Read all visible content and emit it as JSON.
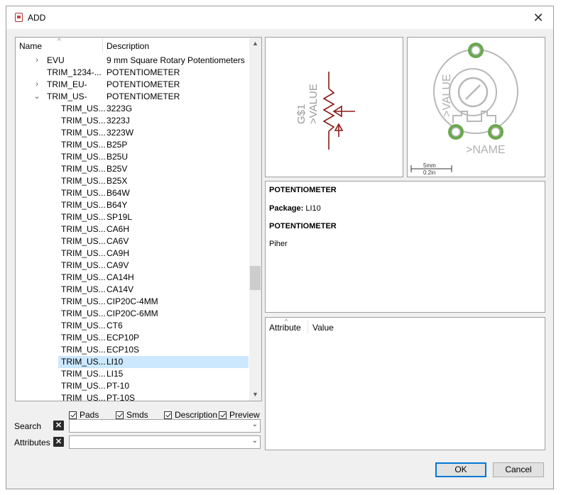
{
  "window": {
    "title": "ADD"
  },
  "tree": {
    "col_name": "Name",
    "col_desc": "Description",
    "rows": [
      {
        "name": "EVU",
        "desc": "9 mm Square Rotary Potentiometers",
        "level": 0,
        "toggle": "collapsed"
      },
      {
        "name": "TRIM_1234-...",
        "desc": "POTENTIOMETER",
        "level": 0,
        "toggle": "none"
      },
      {
        "name": "TRIM_EU-",
        "desc": "POTENTIOMETER",
        "level": 0,
        "toggle": "collapsed"
      },
      {
        "name": "TRIM_US-",
        "desc": "POTENTIOMETER",
        "level": 0,
        "toggle": "expanded"
      },
      {
        "name": "TRIM_US...",
        "desc": "3223G",
        "level": 1
      },
      {
        "name": "TRIM_US...",
        "desc": "3223J",
        "level": 1
      },
      {
        "name": "TRIM_US...",
        "desc": "3223W",
        "level": 1
      },
      {
        "name": "TRIM_US...",
        "desc": "B25P",
        "level": 1
      },
      {
        "name": "TRIM_US...",
        "desc": "B25U",
        "level": 1
      },
      {
        "name": "TRIM_US...",
        "desc": "B25V",
        "level": 1
      },
      {
        "name": "TRIM_US...",
        "desc": "B25X",
        "level": 1
      },
      {
        "name": "TRIM_US...",
        "desc": "B64W",
        "level": 1
      },
      {
        "name": "TRIM_US...",
        "desc": "B64Y",
        "level": 1
      },
      {
        "name": "TRIM_US...",
        "desc": "SP19L",
        "level": 1
      },
      {
        "name": "TRIM_US...",
        "desc": "CA6H",
        "level": 1
      },
      {
        "name": "TRIM_US...",
        "desc": "CA6V",
        "level": 1
      },
      {
        "name": "TRIM_US...",
        "desc": "CA9H",
        "level": 1
      },
      {
        "name": "TRIM_US...",
        "desc": "CA9V",
        "level": 1
      },
      {
        "name": "TRIM_US...",
        "desc": "CA14H",
        "level": 1
      },
      {
        "name": "TRIM_US...",
        "desc": "CA14V",
        "level": 1
      },
      {
        "name": "TRIM_US...",
        "desc": "CIP20C-4MM",
        "level": 1
      },
      {
        "name": "TRIM_US...",
        "desc": "CIP20C-6MM",
        "level": 1
      },
      {
        "name": "TRIM_US...",
        "desc": "CT6",
        "level": 1
      },
      {
        "name": "TRIM_US...",
        "desc": "ECP10P",
        "level": 1
      },
      {
        "name": "TRIM_US...",
        "desc": "ECP10S",
        "level": 1
      },
      {
        "name": "TRIM_US...",
        "desc": "LI10",
        "level": 1,
        "selected": true
      },
      {
        "name": "TRIM_US...",
        "desc": "LI15",
        "level": 1
      },
      {
        "name": "TRIM_US...",
        "desc": "PT-10",
        "level": 1
      },
      {
        "name": "TRIM_US...",
        "desc": "PT-10S",
        "level": 1
      }
    ]
  },
  "options": {
    "pads": "Pads",
    "smds": "Smds",
    "description": "Description",
    "preview": "Preview"
  },
  "search": {
    "label": "Search",
    "value": ""
  },
  "attributes_filter": {
    "label": "Attributes",
    "value": ""
  },
  "symbol_preview": {
    "name_text": "G$1",
    "value_text": ">VALUE",
    "color": "#8b1a1a"
  },
  "package_preview": {
    "value_text": ">VALUE",
    "name_text": ">NAME",
    "scale_mm": "5mm",
    "scale_in": "0.2in",
    "pad_color": "#6aa84f"
  },
  "description_panel": {
    "title": "POTENTIOMETER",
    "package_label": "Package:",
    "package_value": "LI10",
    "subtitle": "POTENTIOMETER",
    "text": "Piher"
  },
  "attribute_table": {
    "col_attribute": "Attribute",
    "col_value": "Value"
  },
  "buttons": {
    "ok": "OK",
    "cancel": "Cancel"
  }
}
